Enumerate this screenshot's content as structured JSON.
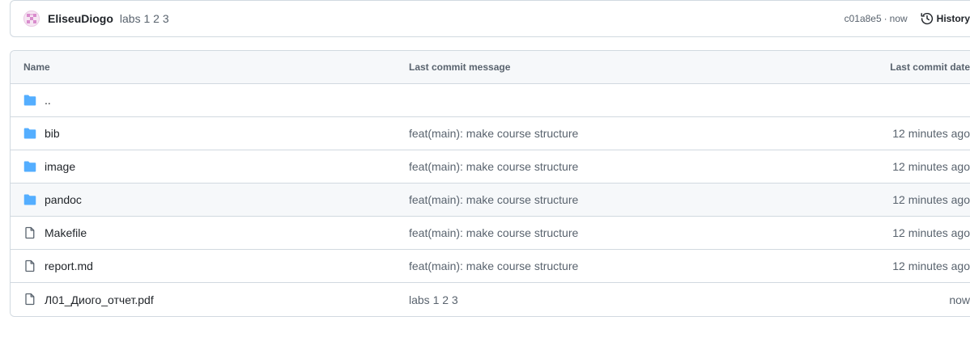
{
  "latest_commit": {
    "author": "EliseuDiogo",
    "message": "labs 1 2 3",
    "sha": "c01a8e5",
    "separator": "·",
    "time": "now",
    "history_label": "History"
  },
  "table": {
    "headers": {
      "name": "Name",
      "message": "Last commit message",
      "date": "Last commit date"
    },
    "rows": [
      {
        "icon": "folder-icon",
        "name": "..",
        "message": "",
        "date": ""
      },
      {
        "icon": "folder-icon",
        "name": "bib",
        "message": "feat(main): make course structure",
        "date": "12 minutes ago"
      },
      {
        "icon": "folder-icon",
        "name": "image",
        "message": "feat(main): make course structure",
        "date": "12 minutes ago"
      },
      {
        "icon": "folder-icon",
        "name": "pandoc",
        "message": "feat(main): make course structure",
        "date": "12 minutes ago"
      },
      {
        "icon": "file-icon",
        "name": "Makefile",
        "message": "feat(main): make course structure",
        "date": "12 minutes ago"
      },
      {
        "icon": "file-icon",
        "name": "report.md",
        "message": "feat(main): make course structure",
        "date": "12 minutes ago"
      },
      {
        "icon": "file-icon",
        "name": "Л01_Диого_отчет.pdf",
        "message": "labs 1 2 3",
        "date": "now"
      }
    ]
  },
  "colors": {
    "folder": "#54aeff",
    "file": "#59636e",
    "border": "#d1d9e0",
    "header_bg": "#f6f8fa"
  }
}
